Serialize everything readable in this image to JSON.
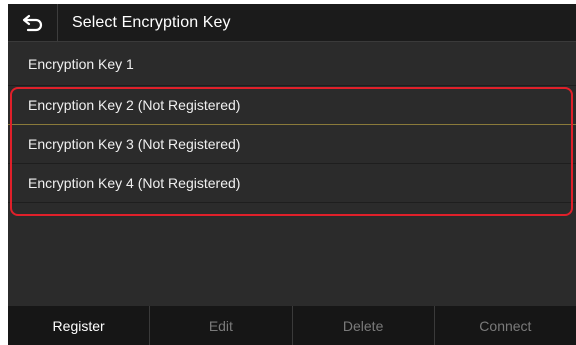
{
  "header": {
    "title": "Select Encryption Key",
    "back_icon": "back-arrow-icon"
  },
  "list": {
    "items": [
      {
        "label": "Encryption Key 1"
      },
      {
        "label": "Encryption Key 2 (Not Registered)"
      },
      {
        "label": "Encryption Key 3 (Not Registered)"
      },
      {
        "label": "Encryption Key 4 (Not Registered)"
      }
    ]
  },
  "toolbar": {
    "register_label": "Register",
    "edit_label": "Edit",
    "delete_label": "Delete",
    "connect_label": "Connect"
  },
  "colors": {
    "background": "#2b2b2b",
    "titlebar": "#1b1b1b",
    "highlight": "#e0202a",
    "active_text": "#ffffff",
    "disabled_text": "#7a7a7a"
  }
}
